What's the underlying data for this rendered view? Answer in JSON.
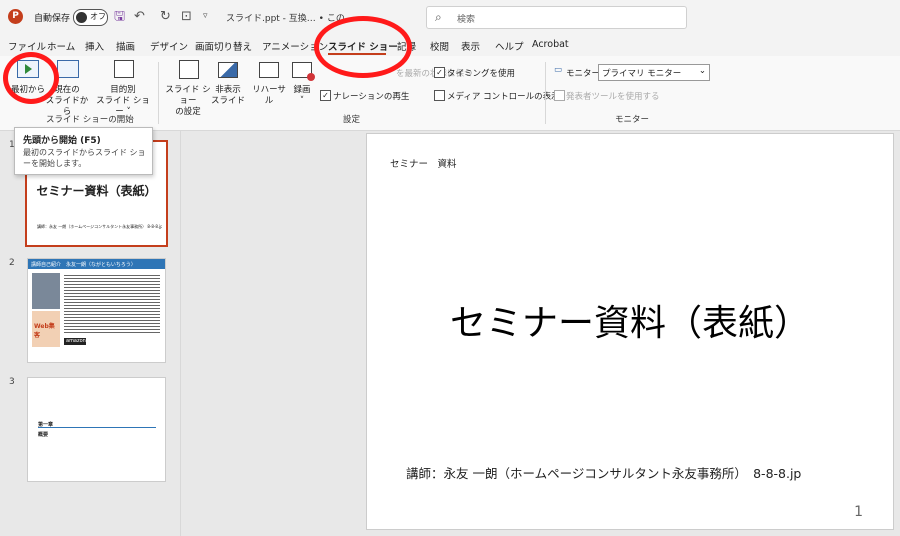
{
  "titlebar": {
    "app_icon": "P",
    "autosave_label": "自動保存",
    "autosave_state": "オフ",
    "doc_title": "スライド.ppt - 互換… • この",
    "search_placeholder": "検索"
  },
  "menu": {
    "tabs": [
      "ファイル",
      "ホーム",
      "挿入",
      "描画",
      "デザイン",
      "画面切り替え",
      "アニメーション",
      "スライド ショー",
      "記録",
      "校閲",
      "表示",
      "ヘルプ",
      "Acrobat"
    ],
    "active": "スライド ショー"
  },
  "ribbon": {
    "start_group": {
      "label": "スライド ショーの開始",
      "from_beginning": "最初から",
      "from_current_l1": "現在の",
      "from_current_l2": "スライドから",
      "custom_l1": "目的別",
      "custom_l2": "スライド ショー ˅"
    },
    "setup_group": {
      "label": "設定",
      "setup_l1": "スライド ショー",
      "setup_l2": "の設定",
      "hide_l1": "非表示",
      "hide_l2": "スライド",
      "rehearse": "リハーサル",
      "record_l1": "録画",
      "record_l2": "˅",
      "keep_updated": "を最新の状態に保つ",
      "play_narration": "ナレーションの再生",
      "use_timings": "タイミングを使用",
      "show_media_controls": "メディア コントロールの表示"
    },
    "monitor_group": {
      "label": "モニター",
      "monitor_label": "モニター:",
      "monitor_value": "プライマリ モニター",
      "presenter_view": "発表者ツールを使用する"
    }
  },
  "tooltip": {
    "title": "先頭から開始 (F5)",
    "body": "最初のスライドからスライド ショーを開始します。"
  },
  "thumbnails": [
    {
      "num": "1",
      "title": "セミナー資料（表紙）",
      "footer": "講師：永友 一朗（ホームページコンサルタント永友事務所） 8-8-8.jp"
    },
    {
      "num": "2",
      "title": "講師自己紹介　永友一朗（ながともいちろう）",
      "badge": "Web集客",
      "store": "amazon"
    },
    {
      "num": "3",
      "line1": "第一章",
      "line2": "概要"
    }
  ],
  "slide": {
    "small_text": "セミナー　資料",
    "title": "セミナー資料（表紙）",
    "subtitle": "講師：永友 一朗（ホームページコンサルタント永友事務所）　8-8-8.jp",
    "number": "1"
  },
  "colors": {
    "accent": "#c43e1c",
    "annotation": "#ff1a1a",
    "link_blue": "#2e75b6"
  }
}
